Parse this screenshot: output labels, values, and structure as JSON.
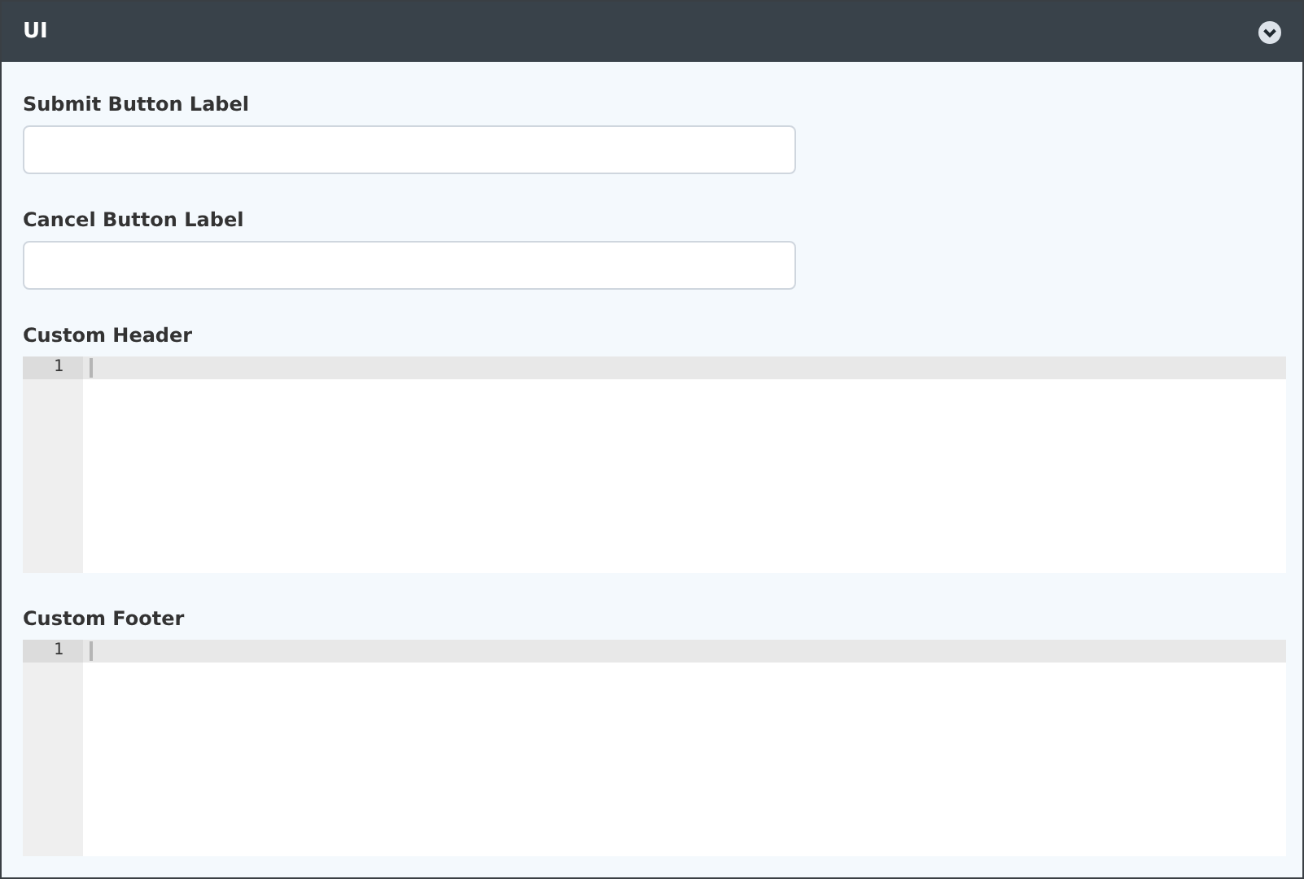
{
  "panel": {
    "title": "UI"
  },
  "fields": [
    {
      "kind": "input",
      "label": "Submit Button Label"
    },
    {
      "kind": "input",
      "label": "Cancel Button Label"
    },
    {
      "kind": "code",
      "label": "Custom Header",
      "line_numbers": [
        "1"
      ]
    },
    {
      "kind": "code",
      "label": "Custom Footer",
      "line_numbers": [
        "1"
      ]
    }
  ]
}
